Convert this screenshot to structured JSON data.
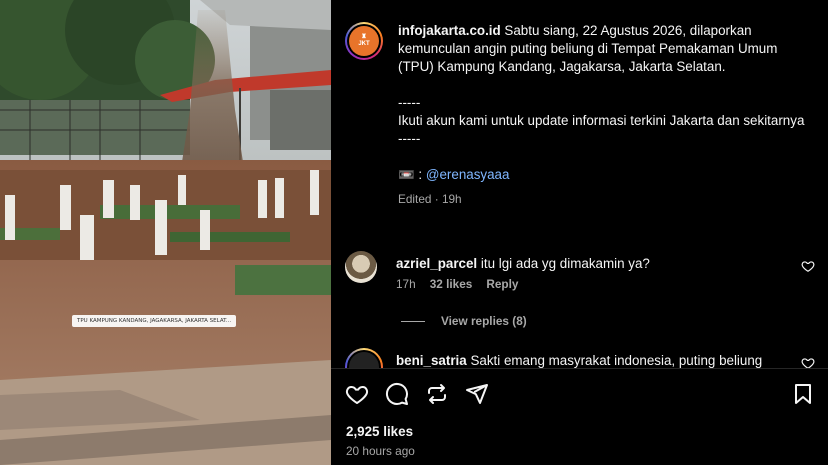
{
  "media": {
    "location_tag": "TPU KAMPUNG KANDANG, JAGAKARSA, JAKARTA SELAT..."
  },
  "post": {
    "account_avatar_text": "JKT",
    "username": "infojakarta.co.id",
    "caption_line1": "Sabtu siang, 22 Agustus 2026, dilaporkan kemunculan angin puting beliung di Tempat Pemakaman Umum (TPU) Kampung Kandang, Jagakarsa, Jakarta Selatan.",
    "separator_top": "-----",
    "caption_line2": "Ikuti akun kami untuk update informasi terkini Jakarta dan sekitarnya",
    "separator_bottom": "-----",
    "credit_icon": "📼",
    "credit_mention": "@erenasyaaa",
    "edited": "Edited",
    "edited_time": "19h"
  },
  "comments": [
    {
      "username": "azriel_parcel",
      "text": "itu lgi ada yg dimakamin ya?",
      "time": "17h",
      "likes": "32 likes",
      "reply": "Reply",
      "view_replies": "View replies (8)"
    },
    {
      "username": "beni_satria",
      "text": "Sakti emang masyrakat indonesia, puting beliung"
    }
  ],
  "footer": {
    "likes": "2,925 likes",
    "posted": "20 hours ago"
  },
  "icons": {
    "like": "heart-icon",
    "comment": "comment-icon",
    "share": "repost-icon",
    "send": "send-icon",
    "save": "bookmark-icon"
  }
}
